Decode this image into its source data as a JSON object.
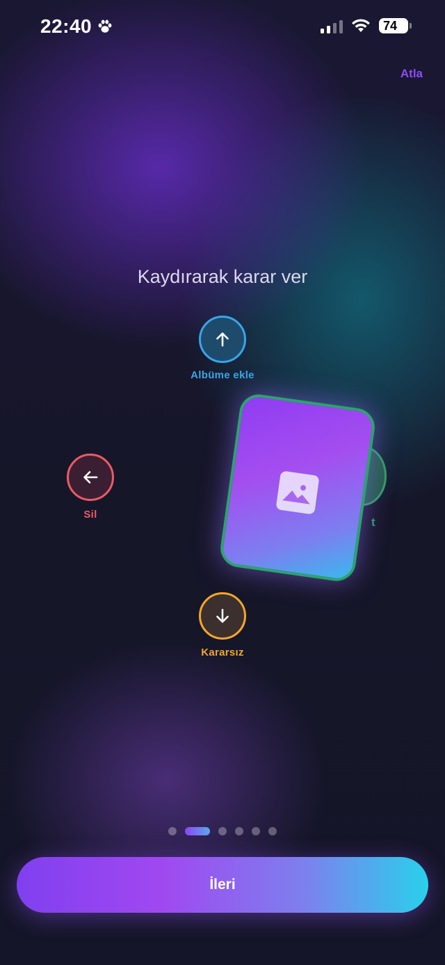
{
  "status_bar": {
    "time": "22:40",
    "battery": "74",
    "icons": [
      "paw-icon",
      "cellular-signal-icon",
      "wifi-icon",
      "battery-icon"
    ]
  },
  "header": {
    "skip_label": "Atla"
  },
  "main": {
    "title": "Kaydırarak karar ver",
    "directions": {
      "up": {
        "label": "Albüme ekle",
        "icon": "arrow-up-icon",
        "color": "#3aa5e8"
      },
      "left": {
        "label": "Sil",
        "icon": "arrow-left-icon",
        "color": "#ec5a63"
      },
      "down": {
        "label": "Kararsız",
        "icon": "arrow-down-icon",
        "color": "#f4a62a"
      },
      "right": {
        "label": "t",
        "color": "#2f9d63"
      }
    },
    "card": {
      "icon": "image-icon"
    }
  },
  "pager": {
    "total": 6,
    "active_index": 1
  },
  "footer": {
    "next_label": "İleri"
  },
  "colors": {
    "accent": "#8c4cf5",
    "background": "#14152a"
  }
}
